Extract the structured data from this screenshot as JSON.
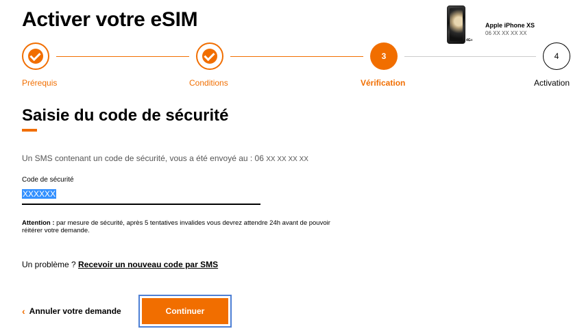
{
  "page": {
    "title": "Activer votre eSIM"
  },
  "device": {
    "name": "Apple iPhone XS",
    "number": "06 XX XX XX XX",
    "badge": "4G+"
  },
  "stepper": {
    "steps": [
      {
        "label": "Prérequis",
        "state": "done"
      },
      {
        "label": "Conditions",
        "state": "done"
      },
      {
        "number": "3",
        "label": "Vérification",
        "state": "current"
      },
      {
        "number": "4",
        "label": "Activation",
        "state": "todo"
      }
    ]
  },
  "section": {
    "title": "Saisie du code de sécurité"
  },
  "sms": {
    "text": "Un SMS contenant un code de sécurité, vous a été envoyé au : 06",
    "number_rest": "XX XX XX XX"
  },
  "code_field": {
    "label": "Code de sécurité",
    "value": "XXXXXX"
  },
  "warning": {
    "bold": "Attention :",
    "text": " par mesure de sécurité, après 5 tentatives invalides vous devrez attendre 24h avant de pouvoir réitérer votre demande."
  },
  "problem": {
    "text": "Un problème ? ",
    "link": "Recevoir un nouveau code par SMS"
  },
  "actions": {
    "cancel": "Annuler votre demande",
    "continue": "Continuer"
  },
  "colors": {
    "accent": "#f16e00",
    "focus": "#4d7fd4"
  }
}
